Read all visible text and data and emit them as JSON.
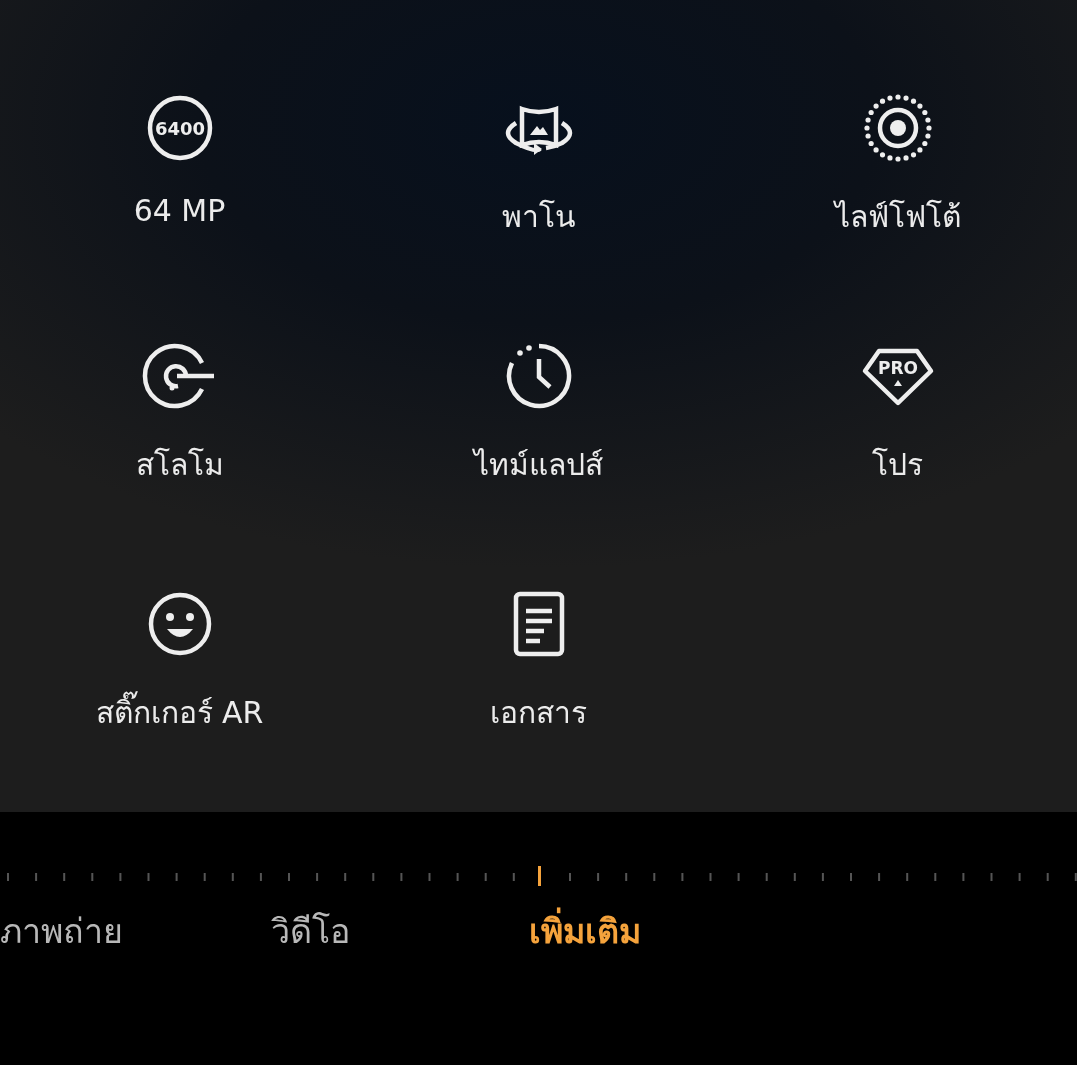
{
  "modes": [
    {
      "label": "64 MP",
      "icon_text": "6400"
    },
    {
      "label": "พาโน"
    },
    {
      "label": "ไลฟ์โฟโต้"
    },
    {
      "label": "สโลโม"
    },
    {
      "label": "ไทม์แลปส์"
    },
    {
      "label": "โปร",
      "icon_text": "PRO"
    },
    {
      "label": "สติ๊กเกอร์ AR"
    },
    {
      "label": "เอกสาร"
    }
  ],
  "tabs": [
    {
      "label": "ภาพถ่าย",
      "selected": false
    },
    {
      "label": "วิดีโอ",
      "selected": false
    },
    {
      "label": "เพิ่มเติม",
      "selected": true
    }
  ]
}
